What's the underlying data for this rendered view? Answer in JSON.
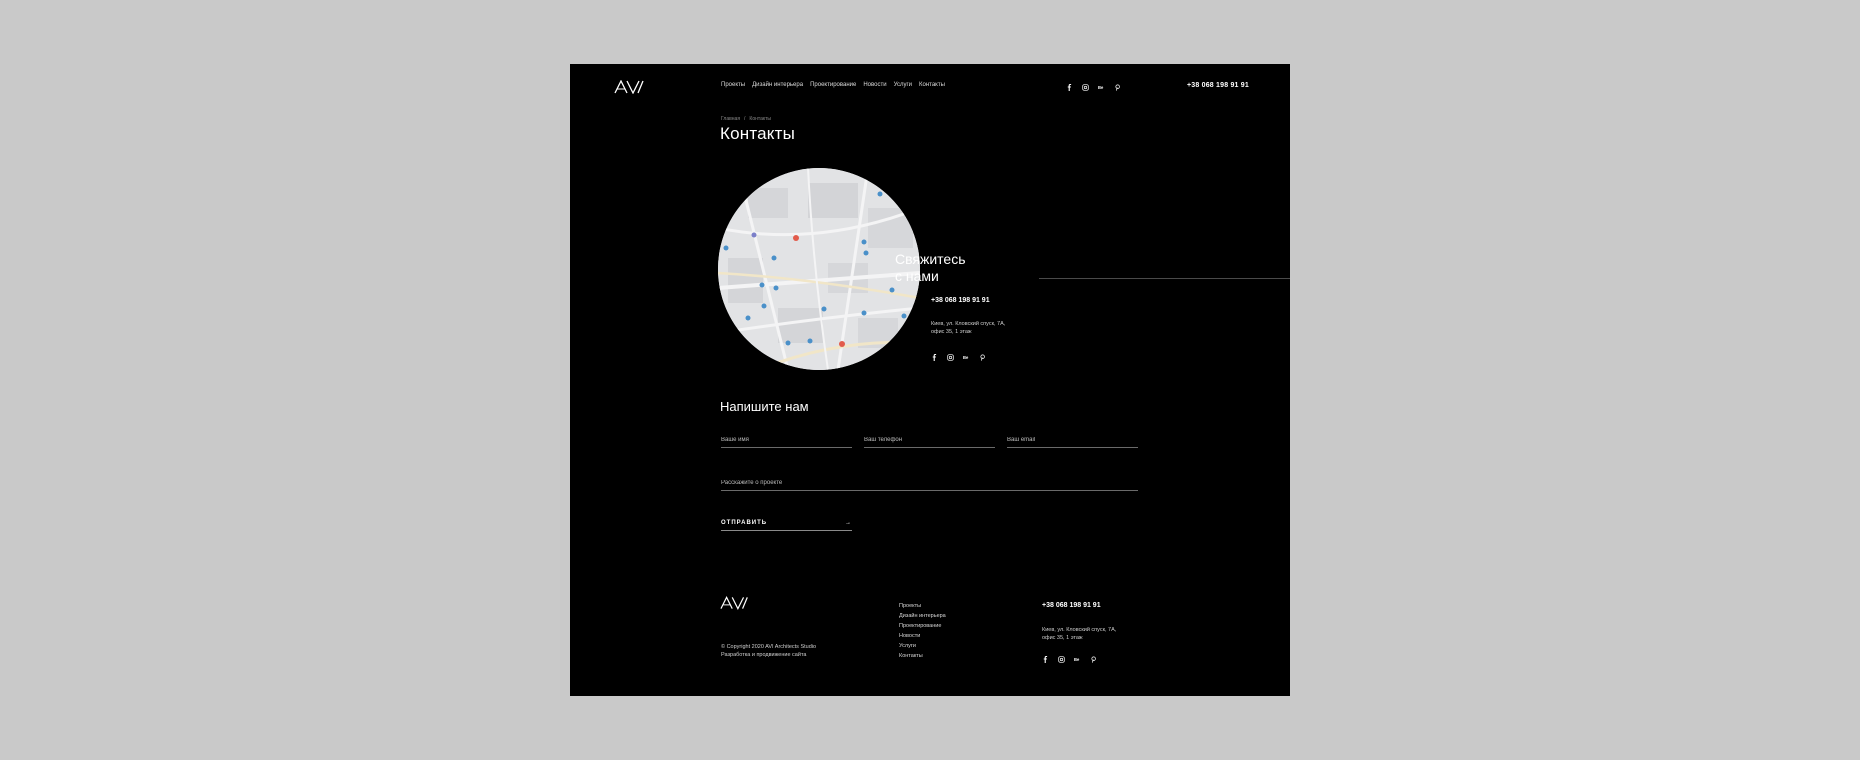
{
  "header": {
    "nav": [
      "Проекты",
      "Дизайн интерьера",
      "Проектирование",
      "Новости",
      "Услуги",
      "Контакты"
    ],
    "phone": "+38 068 198 91 91",
    "social_icons": [
      "facebook-icon",
      "instagram-icon",
      "behance-icon",
      "pinterest-icon"
    ]
  },
  "breadcrumb": {
    "home": "Главная",
    "separator": "/",
    "current": "Контакты"
  },
  "page_title": "Контакты",
  "contact": {
    "title_line1": "Свяжитесь",
    "title_line2": "с нами",
    "phone": "+38 068 198 91 91",
    "address_line1": "Киев, ул. Кловский спуск, 7А,",
    "address_line2": "офис 35, 1 этаж"
  },
  "form": {
    "title": "Напишите нам",
    "name_placeholder": "Ваше имя",
    "phone_placeholder": "Ваш телефон",
    "email_placeholder": "Ваш email",
    "project_placeholder": "Расскажите о проекте",
    "submit_label": "ОТПРАВИТЬ",
    "submit_arrow": "→"
  },
  "footer": {
    "copyright": "© Copyright 2020 AVI Architects Studio",
    "developer": "Разработка и продвижение сайта",
    "nav": [
      "Проекты",
      "Дизайн интерьера",
      "Проектирование",
      "Новости",
      "Услуги",
      "Контакты"
    ],
    "phone": "+38 068 198 91 91",
    "address_line1": "Киев, ул. Кловский спуск, 7А,",
    "address_line2": "офис 35, 1 этаж"
  },
  "colors": {
    "page_bg": "#000000",
    "outer_bg": "#c9c9c9",
    "text": "#ffffff",
    "map_bg": "#e2e3e5"
  }
}
